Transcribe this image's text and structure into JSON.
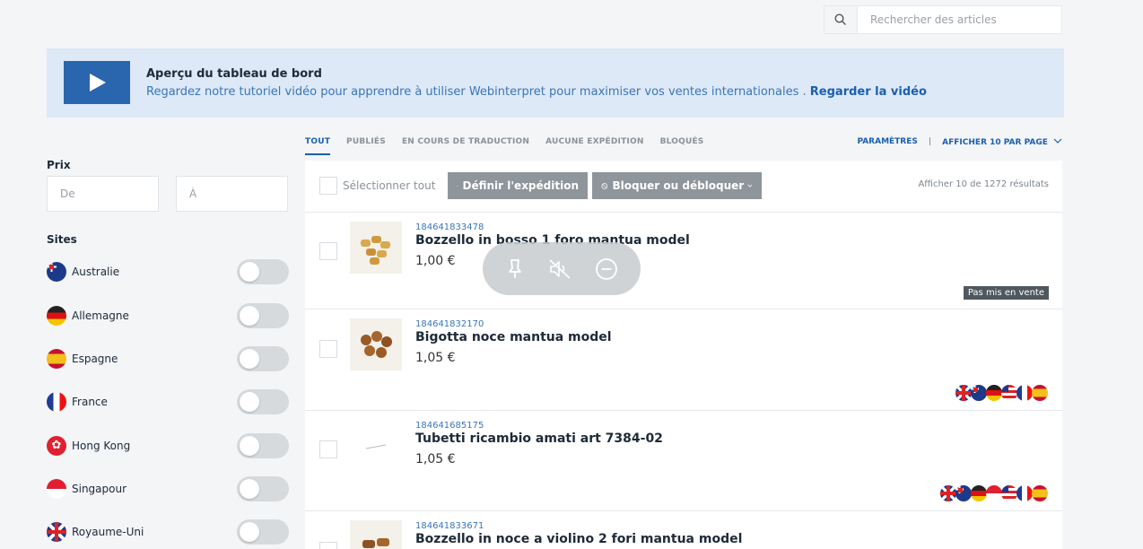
{
  "search": {
    "placeholder": "Rechercher des articles",
    "icon": "search-icon"
  },
  "banner": {
    "title": "Aperçu du tableau de bord",
    "text": "Regardez notre tutoriel vidéo pour apprendre à utiliser Webinterpret pour maximiser vos ventes internationales . ",
    "link": "Regarder la vidéo",
    "icon": "play-icon"
  },
  "filters": {
    "price_label": "Prix",
    "price_from_placeholder": "De",
    "price_to_placeholder": "À",
    "sites_label": "Sites",
    "sites": [
      {
        "name": "Australie",
        "flag": "flag-au",
        "on": false
      },
      {
        "name": "Allemagne",
        "flag": "flag-de",
        "on": false
      },
      {
        "name": "Espagne",
        "flag": "flag-es",
        "on": false
      },
      {
        "name": "France",
        "flag": "flag-fr",
        "on": false
      },
      {
        "name": "Hong Kong",
        "flag": "flag-hk",
        "on": false
      },
      {
        "name": "Singapour",
        "flag": "flag-sg",
        "on": false
      },
      {
        "name": "Royaume-Uni",
        "flag": "flag-uk",
        "on": false
      }
    ]
  },
  "tabs": [
    "TOUT",
    "PUBLIÉS",
    "EN COURS DE TRADUCTION",
    "AUCUNE EXPÉDITION",
    "BLOQUÉS"
  ],
  "tabs_right": {
    "params": "PARAMÈTRES",
    "sep": "|",
    "per_page": "AFFICHER 10 PAR PAGE"
  },
  "toolbar": {
    "select_all": "Sélectionner tout",
    "shipping": "Définir l'expédition",
    "block": "Bloquer ou débloquer",
    "results": "Afficher 10 de 1272 résultats"
  },
  "items": [
    {
      "id": "184641833478",
      "name": "Bozzello in bosso 1 foro mantua model",
      "price": "1,00 €",
      "status": "Pas mis en vente",
      "flags": []
    },
    {
      "id": "184641832170",
      "name": "Bigotta noce mantua model",
      "price": "1,05 €",
      "flags": [
        "uk",
        "au",
        "de",
        "us",
        "fr",
        "es"
      ]
    },
    {
      "id": "184641685175",
      "name": "Tubetti ricambio amati art 7384-02",
      "price": "1,05 €",
      "flags": [
        "uk",
        "au",
        "de",
        "sg",
        "us",
        "fr",
        "es"
      ]
    },
    {
      "id": "184641833671",
      "name": "Bozzello in noce a violino 2 fori mantua model",
      "price": "",
      "flags": []
    }
  ],
  "overlay": {
    "icons": [
      "pin-icon",
      "mute-icon",
      "minus-circle-icon"
    ]
  },
  "colors": {
    "accent": "#1c5fae",
    "banner_bg": "#dde9f7",
    "play": "#2a66ae",
    "button_gray": "#8e959b"
  }
}
